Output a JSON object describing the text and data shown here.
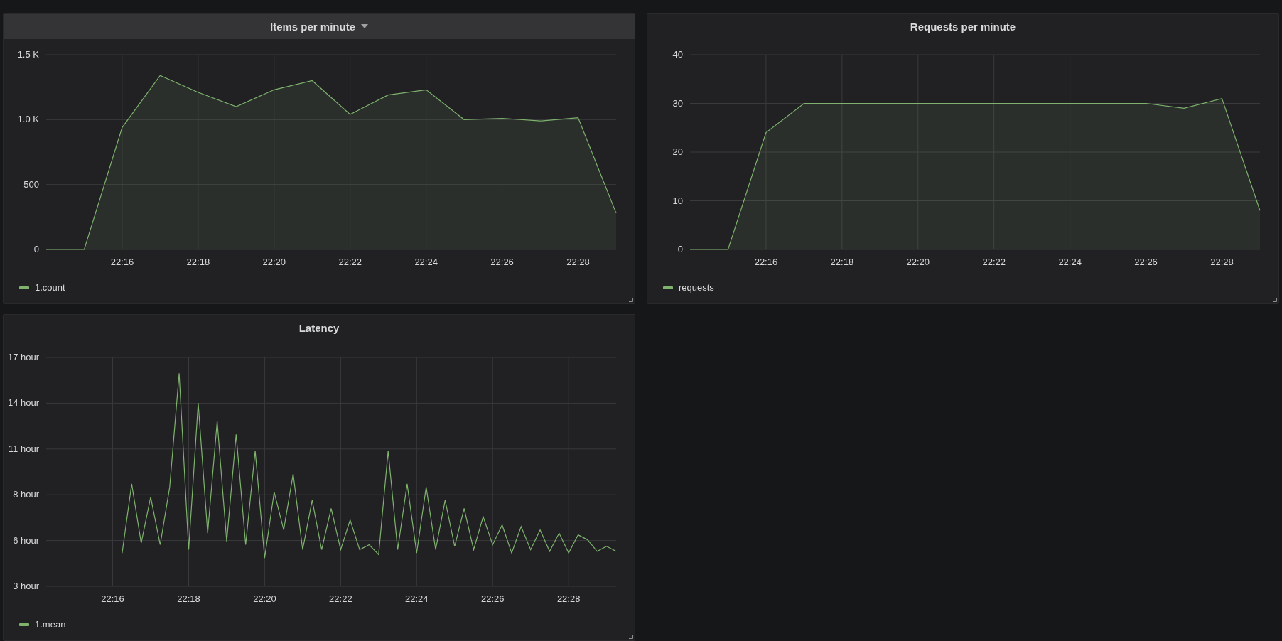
{
  "panels": [
    {
      "title": "Items per minute",
      "hovered": true,
      "chart_data": {
        "type": "area",
        "grid": true,
        "ylim": [
          0,
          1500
        ],
        "categories": [
          null,
          null,
          "22:16",
          null,
          "22:18",
          null,
          "22:20",
          null,
          "22:22",
          null,
          "22:24",
          null,
          "22:26",
          null,
          "22:28",
          null
        ],
        "series": [
          {
            "name": "1.count",
            "color": "#7eb26d",
            "values": [
              0,
              0,
              940,
              1340,
              1210,
              1100,
              1230,
              1300,
              1040,
              1190,
              1230,
              1000,
              1010,
              990,
              1015,
              280
            ]
          }
        ],
        "yticks": [
          0,
          500,
          {
            "value": 1000,
            "label": "1.0 K"
          },
          {
            "value": 1500,
            "label": "1.5 K"
          }
        ]
      }
    },
    {
      "title": "Requests per minute",
      "hovered": false,
      "chart_data": {
        "type": "area",
        "grid": true,
        "ylim": [
          0,
          40
        ],
        "categories": [
          null,
          null,
          "22:16",
          null,
          "22:18",
          null,
          "22:20",
          null,
          "22:22",
          null,
          "22:24",
          null,
          "22:26",
          null,
          "22:28",
          null
        ],
        "series": [
          {
            "name": "requests",
            "color": "#7eb26d",
            "values": [
              0,
              0,
              24,
              30,
              30,
              30,
              30,
              30,
              30,
              30,
              30,
              30,
              30,
              29,
              31,
              8
            ]
          }
        ],
        "yticks": [
          0,
          10,
          20,
          30,
          40
        ]
      }
    },
    {
      "title": "Latency",
      "hovered": false,
      "chart_data": {
        "type": "line",
        "grid": true,
        "ylim": [
          2.778,
          16.667
        ],
        "categories": [
          null,
          null,
          null,
          null,
          null,
          null,
          null,
          "22:16",
          null,
          null,
          null,
          null,
          null,
          null,
          null,
          "22:18",
          null,
          null,
          null,
          null,
          null,
          null,
          null,
          "22:20",
          null,
          null,
          null,
          null,
          null,
          null,
          null,
          "22:22",
          null,
          null,
          null,
          null,
          null,
          null,
          null,
          "22:24",
          null,
          null,
          null,
          null,
          null,
          null,
          null,
          "22:26",
          null,
          null,
          null,
          null,
          null,
          null,
          null,
          "22:28",
          null,
          null,
          null,
          null,
          null
        ],
        "series": [
          {
            "name": "1.mean",
            "color": "#7eb26d",
            "values": [
              null,
              null,
              null,
              null,
              null,
              null,
              null,
              null,
              4.8,
              9.0,
              5.4,
              8.2,
              5.3,
              8.8,
              15.7,
              5.0,
              13.9,
              6.0,
              12.8,
              5.5,
              12.0,
              5.3,
              11.0,
              4.5,
              8.5,
              6.2,
              9.6,
              5.0,
              8.0,
              5.0,
              7.5,
              5.0,
              6.8,
              5.0,
              5.3,
              4.7,
              11.0,
              5.0,
              9.0,
              4.8,
              8.8,
              5.0,
              8.0,
              5.2,
              7.5,
              5.0,
              7.0,
              5.3,
              6.5,
              4.8,
              6.4,
              5.0,
              6.2,
              4.9,
              6.0,
              4.8,
              5.9,
              5.6,
              4.9,
              5.2,
              4.9
            ]
          }
        ],
        "yticks": [
          {
            "value": 2.778,
            "label": "3 hour"
          },
          {
            "value": 5.556,
            "label": "6 hour"
          },
          {
            "value": 8.333,
            "label": "8 hour"
          },
          {
            "value": 11.111,
            "label": "11 hour"
          },
          {
            "value": 13.889,
            "label": "14 hour"
          },
          {
            "value": 16.667,
            "label": "17 hour"
          }
        ]
      }
    }
  ]
}
